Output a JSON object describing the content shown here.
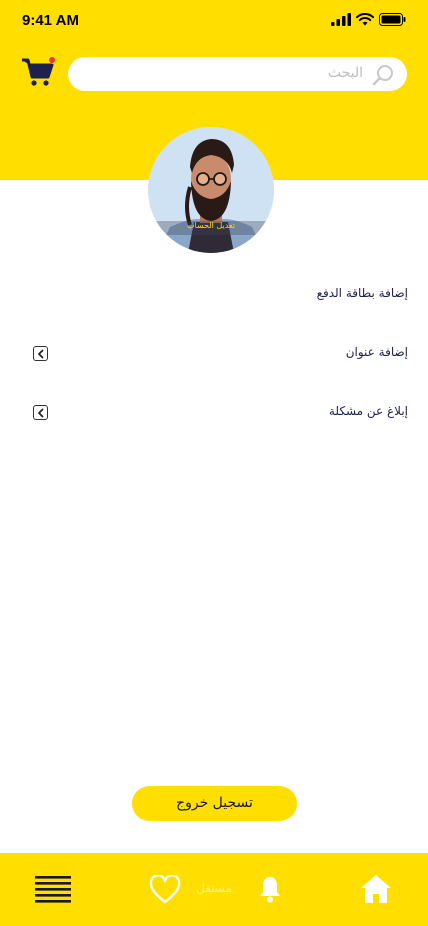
{
  "status_bar": {
    "time": "9:41 AM"
  },
  "header": {
    "search": {
      "placeholder": "البحث"
    },
    "cart_badge_color": "#ff2d2d"
  },
  "profile": {
    "edit_label": "تعديل الحساب"
  },
  "menu": {
    "items": [
      {
        "label": "إضافة بطاقة الدفع",
        "has_arrow": false
      },
      {
        "label": "إضافة عنوان",
        "has_arrow": true
      },
      {
        "label": "إبلاغ عن مشكلة",
        "has_arrow": true
      }
    ]
  },
  "logout": {
    "label": "تسجيل خروج"
  },
  "bottom_nav": {
    "items": [
      "menu-icon",
      "heart-icon",
      "bell-icon",
      "home-icon"
    ],
    "watermark": "مستقل"
  },
  "colors": {
    "brand_yellow": "#ffde00",
    "text_navy": "#1e2050"
  }
}
